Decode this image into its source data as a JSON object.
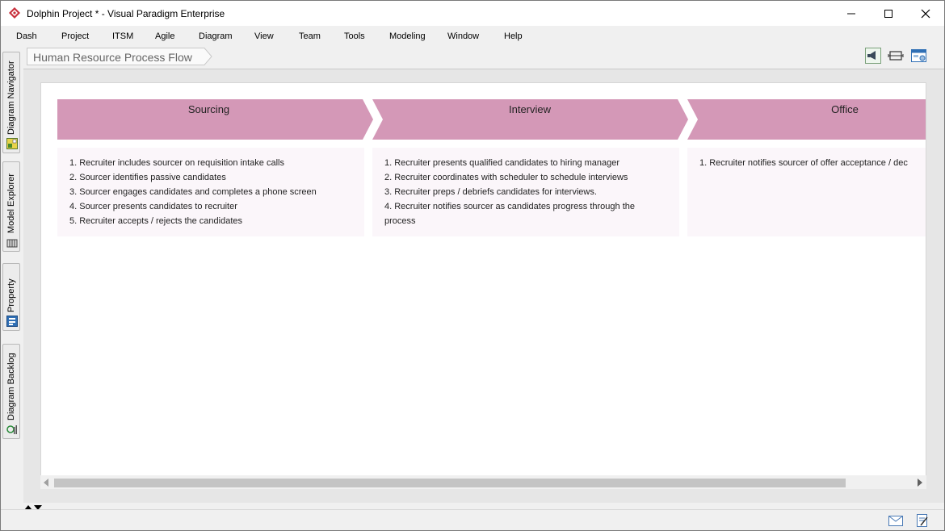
{
  "window": {
    "title": "Dolphin Project * - Visual Paradigm Enterprise"
  },
  "menu": [
    "Dash",
    "Project",
    "ITSM",
    "Agile",
    "Diagram",
    "View",
    "Team",
    "Tools",
    "Modeling",
    "Window",
    "Help"
  ],
  "side_tabs": [
    "Diagram Navigator",
    "Model Explorer",
    "Property",
    "Diagram Backlog"
  ],
  "breadcrumb": "Human Resource Process Flow",
  "colors": {
    "stage_header": "#d498b7",
    "stage_body": "#fbf6fa",
    "brand": "#c8303c"
  },
  "stages": [
    {
      "name": "Sourcing",
      "steps": [
        "1. Recruiter includes sourcer on requisition intake calls",
        "2. Sourcer identifies passive candidates",
        "3. Sourcer engages candidates and completes a phone screen",
        "4. Sourcer presents candidates to recruiter",
        "5. Recruiter accepts / rejects the candidates"
      ]
    },
    {
      "name": "Interview",
      "steps": [
        "1. Recruiter presents qualified candidates to hiring manager",
        "2. Recruiter coordinates with scheduler to schedule interviews",
        "3. Recruiter preps / debriefs candidates for interviews.",
        "4. Recruiter notifies sourcer as candidates progress through the",
        "process"
      ]
    },
    {
      "name": "Office",
      "steps": [
        "1. Recruiter notifies sourcer of offer acceptance / dec"
      ]
    }
  ]
}
